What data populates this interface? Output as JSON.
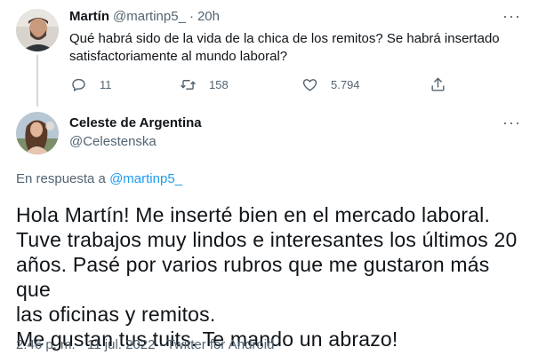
{
  "tweet1": {
    "name": "Martín",
    "handle": "@martinp5_",
    "separator": "·",
    "time": "20h",
    "more": "···",
    "text": "Qué habrá sido de la vida de la chica de los remitos? Se habrá insertado satisfactoriamente al mundo laboral?",
    "actions": {
      "replies": "11",
      "retweets": "158",
      "likes": "5.794"
    }
  },
  "tweet2": {
    "name": "Celeste de Argentina",
    "handle": "@Celestenska",
    "more": "···",
    "reply_prefix": "En respuesta a",
    "reply_handle": "@martinp5_",
    "text_lines": [
      "Hola Martín! Me inserté bien en el mercado laboral.",
      "Tuve trabajos muy lindos e interesantes los últimos 20",
      "años. Pasé por varios rubros que me gustaron más que",
      "las oficinas y remitos.",
      "Me gustan tus tuits. Te mando un abrazo!"
    ],
    "timestamp": "2:46 p. m. · 11 jul. 2022 · Twitter for Android"
  },
  "icons": {
    "reply": "reply-icon",
    "retweet": "retweet-icon",
    "like": "heart-icon",
    "share": "share-icon"
  },
  "colors": {
    "accent": "#1d9bf0",
    "text": "#0f1419",
    "muted": "#536471",
    "thread_line": "#cfd9de"
  }
}
